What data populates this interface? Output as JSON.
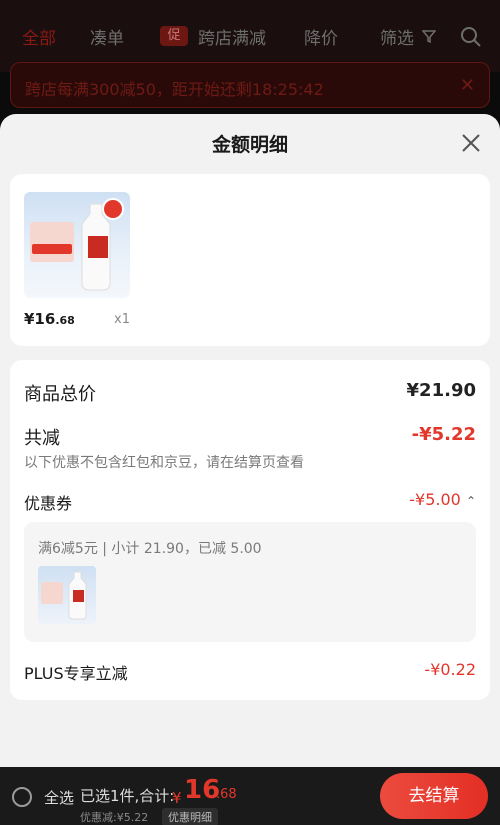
{
  "tabs": [
    {
      "label": "全部"
    },
    {
      "label": "凑单"
    },
    {
      "label": "跨店满减",
      "badge": "促"
    },
    {
      "label": "降价"
    },
    {
      "label": "筛选"
    }
  ],
  "countdown_banner": {
    "text": "跨店每满300减50，距开始还剩18:25:42"
  },
  "sheet": {
    "title": "金额明细",
    "product": {
      "price_int": "¥16",
      "price_dec": ".68",
      "quantity": "x1"
    },
    "detail": {
      "total_label": "商品总价",
      "total_value": "¥21.90",
      "discount_label": "共减",
      "discount_value": "-¥5.22",
      "note": "以下优惠不包含红包和京豆，请在结算页查看",
      "coupon_label": "优惠券",
      "coupon_value": "-¥5.00",
      "coupon_summary": "满6减5元 | 小计 21.90，已减 5.00",
      "plus_label": "PLUS专享立减",
      "plus_value": "-¥0.22"
    }
  },
  "bottom_bar": {
    "select_all": "全选",
    "selected_summary": "已选1件,合计:",
    "total_symbol": "¥",
    "total_int": "16",
    "total_dec": ".68",
    "discount_line": "优惠减:¥5.22",
    "detail_chip": "优惠明细",
    "checkout": "去结算"
  },
  "colors": {
    "accent_red": "#e2372b",
    "background_dim": "#0b0b0b"
  }
}
